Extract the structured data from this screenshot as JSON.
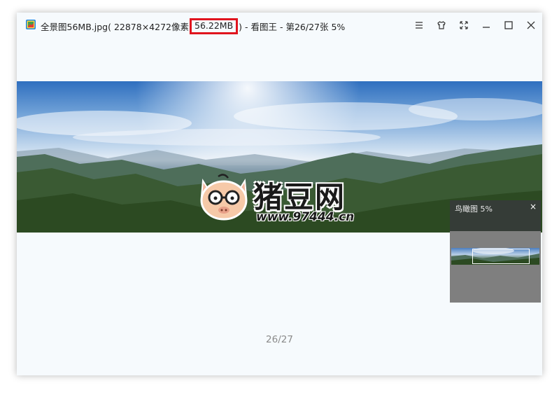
{
  "titlebar": {
    "filename": "全景图56MB.jpg",
    "dimensions": "( 22878×4272像素",
    "filesize": "56.22MB",
    "suffix": ") - 看图王 - 第26/27张 5%"
  },
  "window_controls": {
    "icons": [
      "menu-icon",
      "skin-icon",
      "fullscreen-icon",
      "minimize-icon",
      "maximize-icon",
      "close-icon"
    ]
  },
  "watermark": {
    "title": "猪豆网",
    "url": "www.97444.cn"
  },
  "birdseye": {
    "title": "鸟瞰图 5%",
    "close_label": "×"
  },
  "footer": {
    "page_counter": "26/27"
  },
  "colors": {
    "highlight": "#e0141e",
    "window_bg": "#f6fafd"
  }
}
